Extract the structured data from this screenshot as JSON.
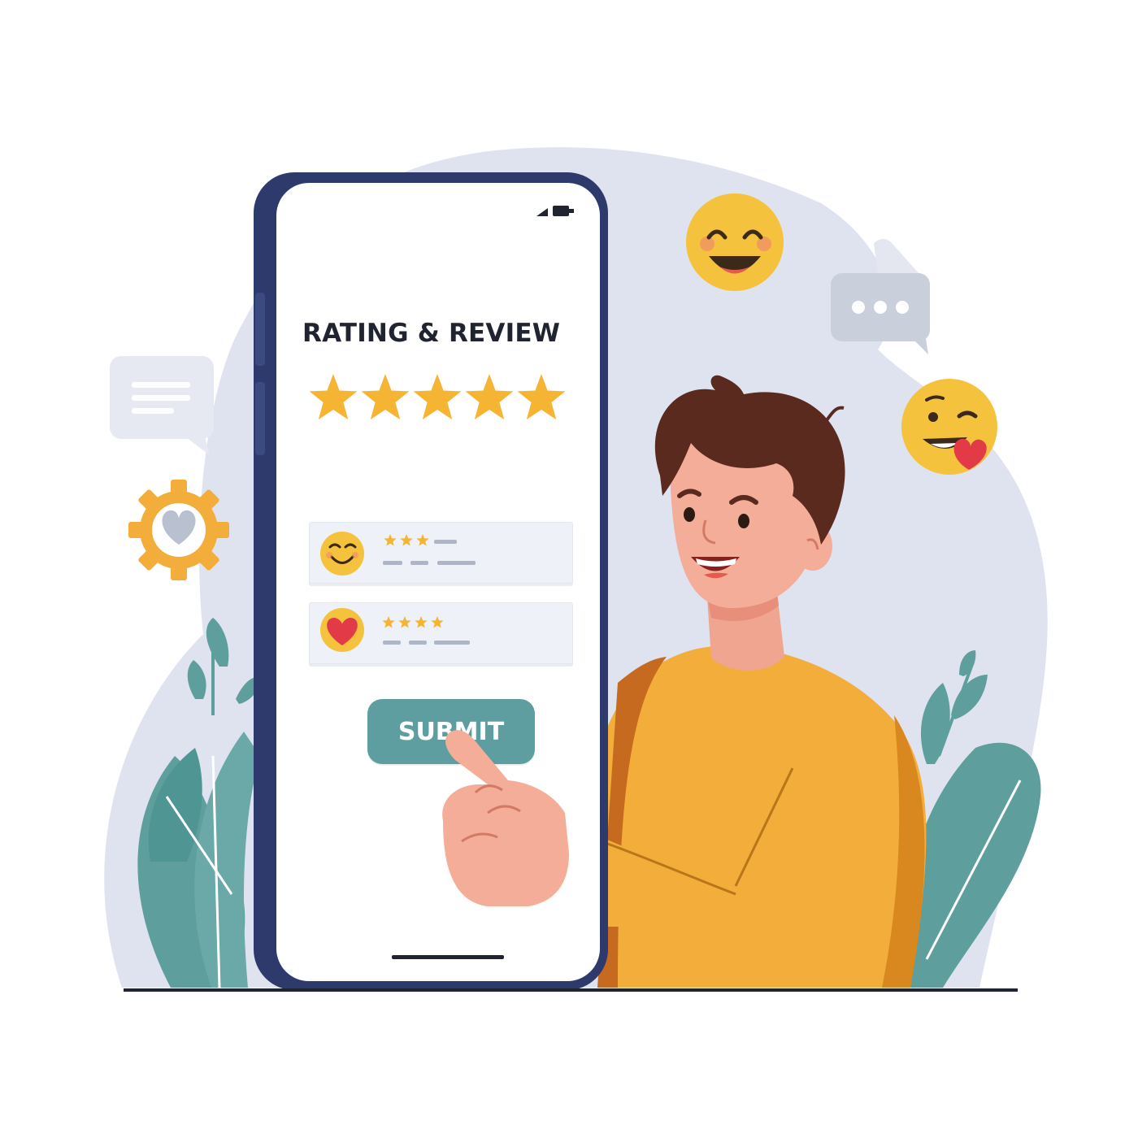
{
  "app": {
    "screen_title": "RATING & REVIEW",
    "overall_rating": {
      "stars": 5,
      "max": 5
    },
    "reviews": [
      {
        "stars": 3,
        "avatar": "smile-emoji-icon"
      },
      {
        "stars": 4,
        "avatar": "heart-icon"
      }
    ],
    "submit_label": "SUBMIT"
  },
  "decor": {
    "icons": [
      "chat-bubble-icon",
      "heart-gear-icon",
      "laughing-emoji-icon",
      "typing-bubble-icon",
      "heart-kiss-emoji-icon"
    ]
  },
  "colors": {
    "accent": "#5f9ea0",
    "star": "#f5b431",
    "phone_frame": "#2e3a6b",
    "sweater": "#f2ad3a",
    "blob": "#dfe3ef"
  }
}
